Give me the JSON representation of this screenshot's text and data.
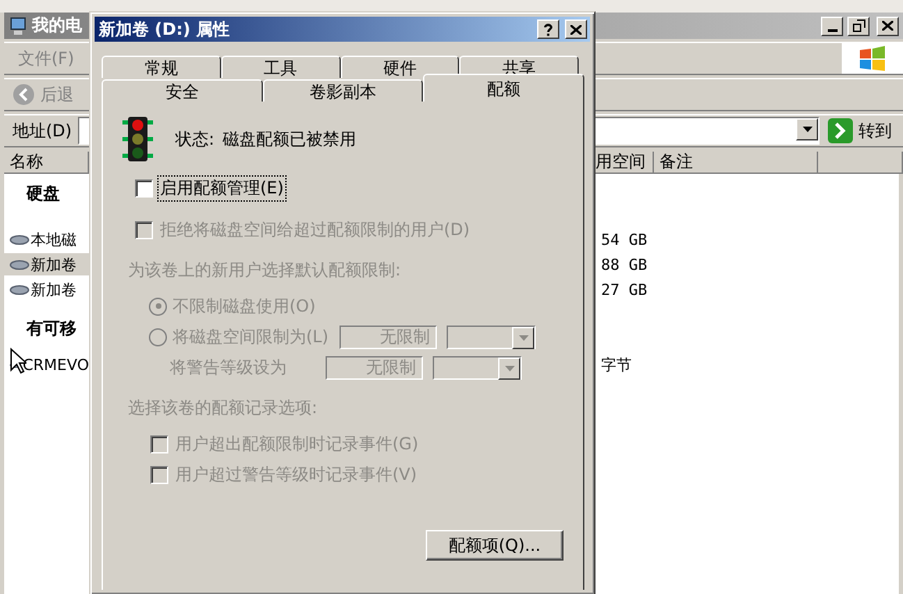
{
  "explorer": {
    "title": "我的电",
    "menu": [
      {
        "label": "文件(F)"
      }
    ],
    "back_button": "后退",
    "address_label": "地址(D)",
    "go_button": "转到",
    "columns": [
      "名称",
      "用空间",
      "备注"
    ],
    "groups": [
      {
        "label": "硬盘",
        "items": [
          {
            "name": "本地磁",
            "size": "54 GB",
            "selected": false
          },
          {
            "name": "新加卷",
            "size": "88 GB",
            "selected": true
          },
          {
            "name": "新加卷",
            "size": "27 GB",
            "selected": false
          }
        ]
      },
      {
        "label": "有可移",
        "items": [
          {
            "name": "CRMEVO",
            "size": "字节",
            "selected": false
          }
        ]
      }
    ]
  },
  "dialog": {
    "title": "新加卷 (D:) 属性",
    "tab_rows": [
      [
        {
          "label": "常规",
          "selected": false
        },
        {
          "label": "工具",
          "selected": false
        },
        {
          "label": "硬件",
          "selected": false
        },
        {
          "label": "共享",
          "selected": false
        }
      ],
      [
        {
          "label": "安全",
          "selected": false
        },
        {
          "label": "卷影副本",
          "selected": false
        },
        {
          "label": "配额",
          "selected": true
        }
      ]
    ],
    "status_label": "状态:",
    "status_value": "磁盘配额已被禁用",
    "enable_quota": {
      "label": "启用配额管理(E)",
      "checked": false,
      "disabled": false,
      "focused": true
    },
    "deny_space": {
      "label": "拒绝将磁盘空间给超过配额限制的用户(D)",
      "checked": false,
      "disabled": true,
      "focused": false
    },
    "default_limit_label": "为该卷上的新用户选择默认配额限制:",
    "limit_options": [
      {
        "kind": "plain",
        "label": "不限制磁盘使用(O)",
        "selected": true,
        "disabled": true
      },
      {
        "kind": "limit",
        "label": "将磁盘空间限制为(L)",
        "selected": false,
        "disabled": true,
        "value": "无限制"
      }
    ],
    "warning_level": {
      "label": "将警告等级设为",
      "value": "无限制",
      "disabled": true
    },
    "logging_label": "选择该卷的配额记录选项:",
    "log_options": [
      {
        "label": "用户超出配额限制时记录事件(G)",
        "checked": false,
        "disabled": true,
        "focused": false
      },
      {
        "label": "用户超过警告等级时记录事件(V)",
        "checked": false,
        "disabled": true,
        "focused": false
      }
    ],
    "quota_entries_button": "配额项(Q)..."
  }
}
